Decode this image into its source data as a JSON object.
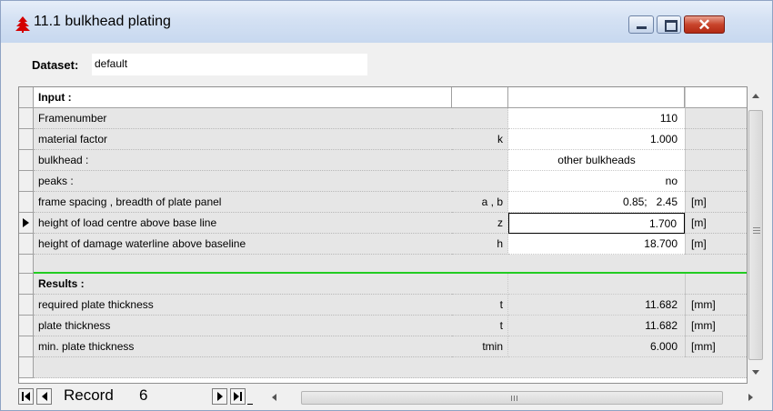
{
  "window": {
    "title": "11.1 bulkhead plating",
    "icon": "tree-icon",
    "close_glyph": "✕"
  },
  "dataset": {
    "label": "Dataset:",
    "value": "default"
  },
  "grid": {
    "header": {
      "description": "Input :"
    },
    "input_rows": [
      {
        "description": "Framenumber",
        "symbol": "",
        "value": "110",
        "unit": ""
      },
      {
        "description": "material factor",
        "symbol": "k",
        "value": "1.000",
        "unit": ""
      },
      {
        "description": "bulkhead :",
        "symbol": "",
        "value": "other bulkheads",
        "unit": ""
      },
      {
        "description": "peaks :",
        "symbol": "",
        "value": "no",
        "unit": ""
      },
      {
        "description": "frame spacing , breadth of plate panel",
        "symbol": "a , b",
        "value": "0.85;   2.45",
        "unit": "[m]"
      },
      {
        "description": "height of load centre above base line",
        "symbol": "z",
        "value": "1.700",
        "unit": "[m]"
      },
      {
        "description": "height of damage waterline above baseline",
        "symbol": "h",
        "value": "18.700",
        "unit": "[m]"
      }
    ],
    "results_header": {
      "description": "Results :"
    },
    "result_rows": [
      {
        "description": "required plate thickness",
        "symbol": "t",
        "value": "11.682",
        "unit": "[mm]"
      },
      {
        "description": "plate thickness",
        "symbol": "t",
        "value": "11.682",
        "unit": "[mm]"
      },
      {
        "description": "min. plate thickness",
        "symbol": "tmin",
        "value": "6.000",
        "unit": "[mm]"
      }
    ],
    "current_row_index": 5
  },
  "navigator": {
    "record_label": "Record",
    "record_number": "6"
  },
  "colors": {
    "separator": "#22cc22",
    "title_bar": "#d4e1f3",
    "close_button": "#c8442b"
  }
}
